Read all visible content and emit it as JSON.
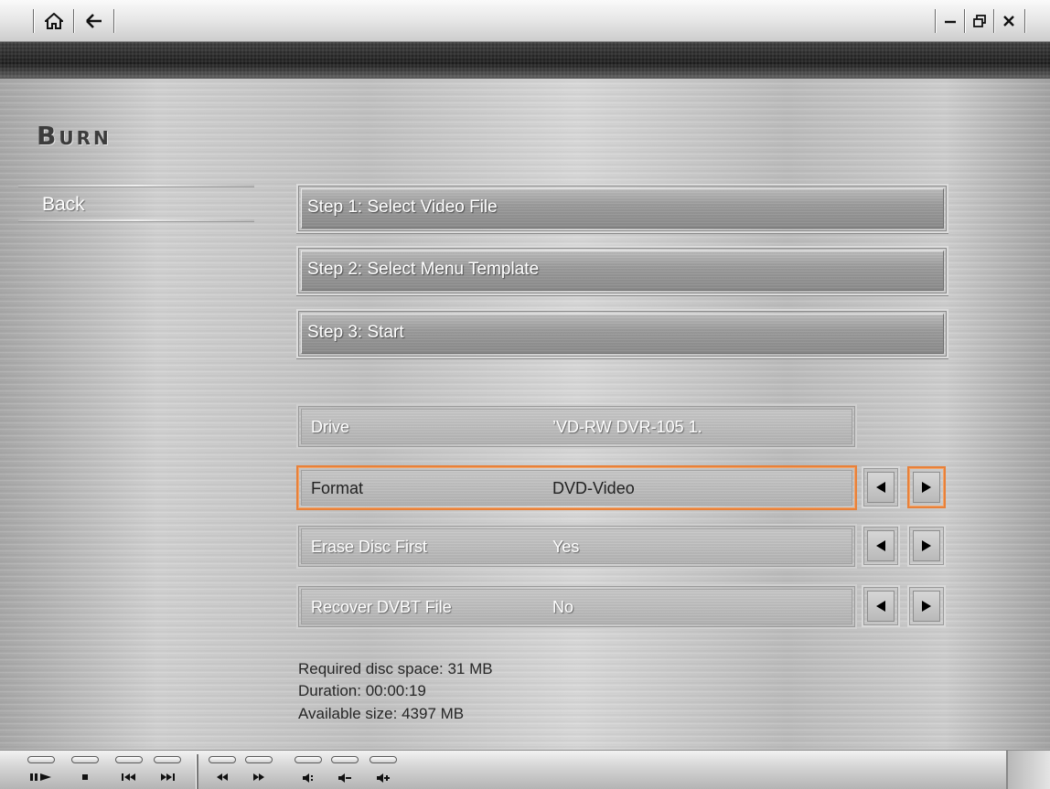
{
  "titlebar": {
    "home_icon": "home-icon",
    "back_icon": "arrow-left-icon",
    "minimize_icon": "minimize-icon",
    "restore_icon": "restore-icon",
    "close_icon": "close-icon"
  },
  "page": {
    "title": "Burn",
    "back_label": "Back"
  },
  "steps": [
    {
      "label": "Step 1: Select Video File"
    },
    {
      "label": "Step 2: Select Menu Template"
    },
    {
      "label": "Step 3: Start"
    }
  ],
  "settings": [
    {
      "label": "Drive",
      "value": "’VD-RW DVR-105  1."
    },
    {
      "label": "Format",
      "value": "DVD-Video"
    },
    {
      "label": "Erase Disc First",
      "value": "Yes"
    },
    {
      "label": "Recover DVBT File",
      "value": "No"
    }
  ],
  "info": {
    "required_space": "Required disc space: 31 MB",
    "duration": "Duration: 00:00:19",
    "available_size": "Available size: 4397 MB"
  },
  "controls": [
    {
      "name": "play-pause-icon"
    },
    {
      "name": "stop-icon"
    },
    {
      "name": "previous-track-icon"
    },
    {
      "name": "next-track-icon"
    },
    {
      "name": "rewind-icon"
    },
    {
      "name": "fast-forward-icon"
    },
    {
      "name": "mute-icon"
    },
    {
      "name": "volume-down-icon"
    },
    {
      "name": "volume-up-icon"
    }
  ],
  "colors": {
    "selection": "#e8813a",
    "label_text": "#ffffff",
    "info_text": "#262626"
  }
}
